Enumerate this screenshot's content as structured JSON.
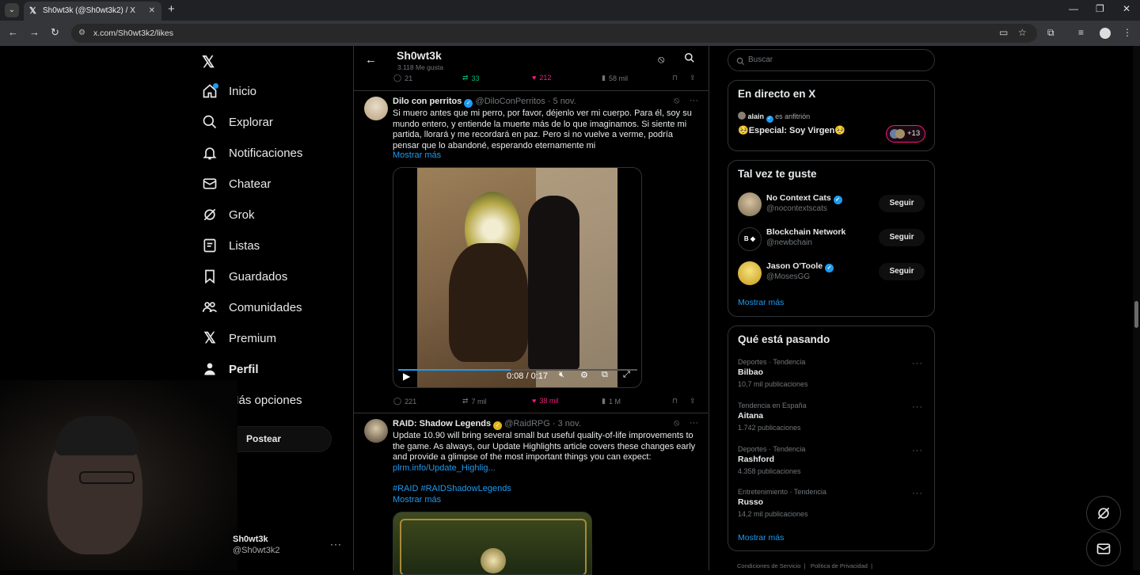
{
  "browser": {
    "tab_title": "Sh0wt3k (@Sh0wt3k2) / X",
    "url": "x.com/Sh0wt3k2/likes"
  },
  "sidebar": {
    "items": [
      {
        "label": "Inicio",
        "icon": "home-icon"
      },
      {
        "label": "Explorar",
        "icon": "search-icon"
      },
      {
        "label": "Notificaciones",
        "icon": "bell-icon"
      },
      {
        "label": "Chatear",
        "icon": "mail-icon"
      },
      {
        "label": "Grok",
        "icon": "grok-icon"
      },
      {
        "label": "Listas",
        "icon": "list-icon"
      },
      {
        "label": "Guardados",
        "icon": "bookmark-icon"
      },
      {
        "label": "Comunidades",
        "icon": "communities-icon"
      },
      {
        "label": "Premium",
        "icon": "x-logo-icon"
      },
      {
        "label": "Perfil",
        "icon": "person-icon"
      },
      {
        "label": "Más opciones",
        "icon": "more-circle-icon"
      }
    ],
    "post_label": "Postear",
    "account": {
      "name": "Sh0wt3k",
      "handle": "@Sh0wt3k2"
    }
  },
  "header": {
    "title": "Sh0wt3k",
    "subtitle": "3.118 Me gusta"
  },
  "top_actions": {
    "replies": "21",
    "reposts": "33",
    "likes": "212",
    "views": "58 mil"
  },
  "tweets": [
    {
      "author": "Dilo con perritos",
      "handle": "@DiloConPerritos",
      "date": "· 5 nov.",
      "text": "Si muero antes que mi perro, por favor, déjenlo ver mi cuerpo. Para él, soy su mundo entero, y entiende la muerte más de lo que imaginamos. Si siente mi partida, llorará y me recordará en paz. Pero si no vuelve a verme, podría pensar que lo abandoné, esperando eternamente mi",
      "show_more": "Mostrar más",
      "video_time": "0:08 / 0:17",
      "video_progress": 0.47,
      "replies": "221",
      "reposts": "7 mil",
      "likes": "38 mil",
      "views": "1 M"
    },
    {
      "author": "RAID: Shadow Legends",
      "handle": "@RaidRPG",
      "date": "· 3 nov.",
      "text": "Update 10.90 will bring several small but useful quality-of-life improvements to the game. As always, our Update Highlights article covers these changes early and provide a glimpse of the most important things you can expect:",
      "link": "plrm.info/Update_Highlig...",
      "hashtags": "#RAID #RAIDShadowLegends",
      "show_more": "Mostrar más"
    }
  ],
  "right": {
    "search_placeholder": "Buscar",
    "live": {
      "title": "En directo en X",
      "host": "alain",
      "host_note": "es anfitrión",
      "space_title": "🥺Especial: Soy Virgen🥺",
      "listeners": "+13"
    },
    "suggest": {
      "title": "Tal vez te guste",
      "users": [
        {
          "name": "No Context Cats",
          "handle": "@nocontextscats",
          "button": "Seguir"
        },
        {
          "name": "Blockchain Network",
          "handle": "@newbchain",
          "button": "Seguir"
        },
        {
          "name": "Jason O'Toole",
          "handle": "@MosesGG",
          "button": "Seguir"
        }
      ],
      "more": "Mostrar más"
    },
    "trends": {
      "title": "Qué está pasando",
      "items": [
        {
          "category": "Deportes · Tendencia",
          "name": "Bilbao",
          "count": "10,7 mil publicaciones"
        },
        {
          "category": "Tendencia en España",
          "name": "Aitana",
          "count": "1.742 publicaciones"
        },
        {
          "category": "Deportes · Tendencia",
          "name": "Rashford",
          "count": "4.358 publicaciones"
        },
        {
          "category": "Entretenimiento · Tendencia",
          "name": "Russo",
          "count": "14,2 mil publicaciones"
        }
      ],
      "more": "Mostrar más"
    },
    "footer": "Condiciones de Servicio  |   Política de Privacidad  |"
  },
  "colors": {
    "accent": "#1d9bf0",
    "like": "#f91880",
    "repost": "#00ba7c",
    "background": "#000000"
  }
}
